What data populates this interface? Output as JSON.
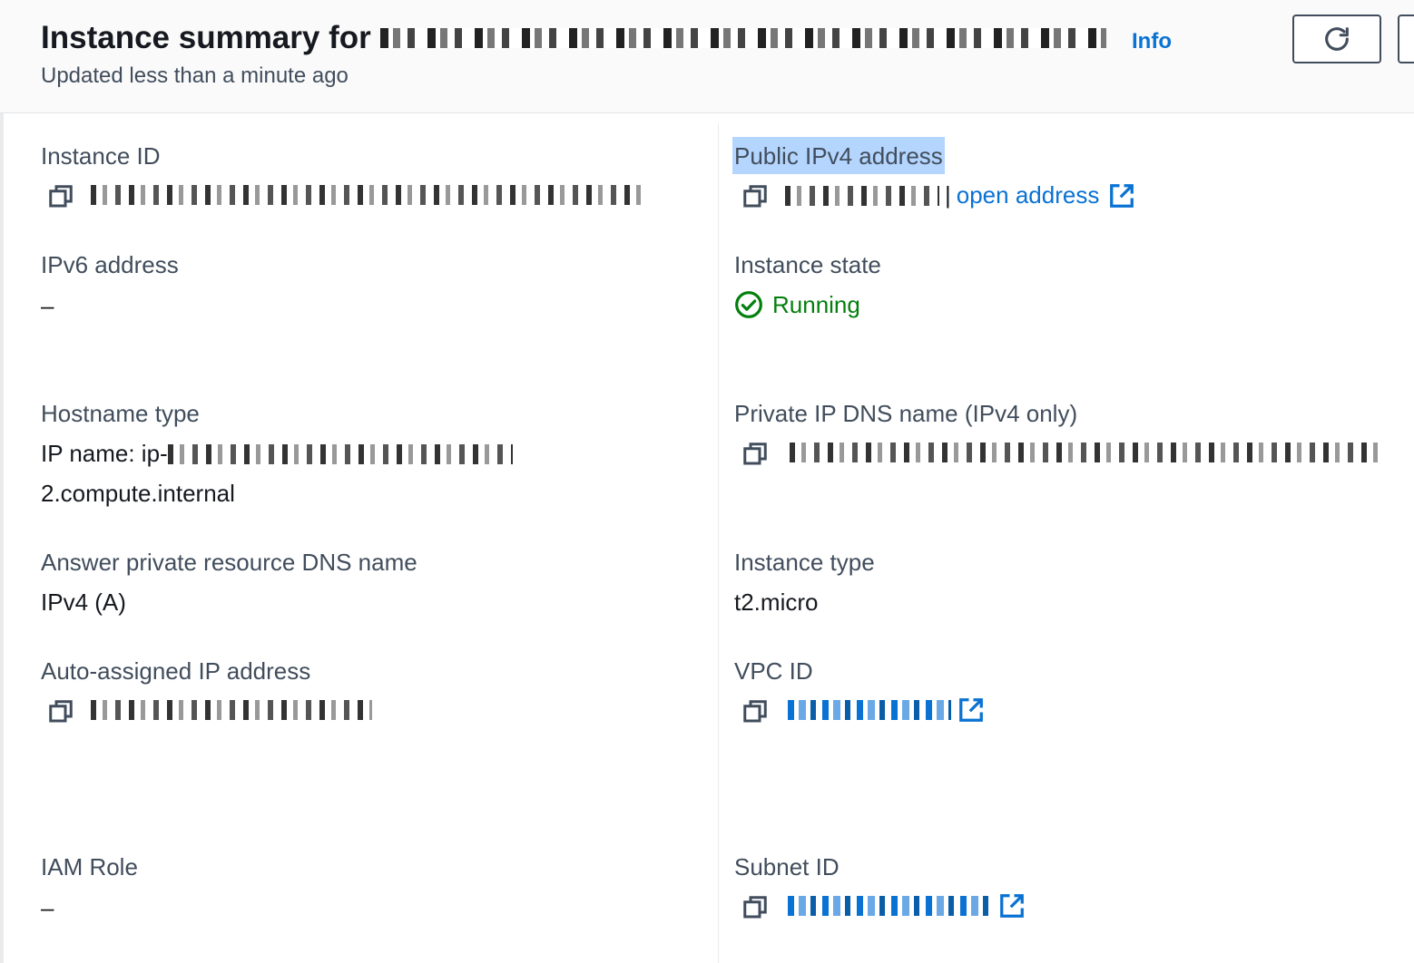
{
  "header": {
    "title_prefix": "Instance summary for",
    "info_label": "Info",
    "updated_text": "Updated less than a minute ago"
  },
  "left": {
    "instance_id": {
      "label": "Instance ID"
    },
    "ipv6": {
      "label": "IPv6 address",
      "value": "–"
    },
    "hostname_type": {
      "label": "Hostname type",
      "value_prefix": "IP name: ip-",
      "value_line2": "2.compute.internal"
    },
    "answer_dns": {
      "label": "Answer private resource DNS name",
      "value": "IPv4 (A)"
    },
    "auto_ip": {
      "label": "Auto-assigned IP address"
    },
    "iam_role": {
      "label": "IAM Role",
      "value": "–"
    }
  },
  "right": {
    "public_ipv4": {
      "label": "Public IPv4 address",
      "separator": "|",
      "open_link": "open address"
    },
    "instance_state": {
      "label": "Instance state",
      "value": "Running"
    },
    "private_dns": {
      "label": "Private IP DNS name (IPv4 only)"
    },
    "instance_type": {
      "label": "Instance type",
      "value": "t2.micro"
    },
    "vpc_id": {
      "label": "VPC ID"
    },
    "subnet_id": {
      "label": "Subnet ID"
    }
  },
  "icons": {
    "copy": "copy-icon",
    "external": "external-link-icon",
    "refresh": "refresh-icon",
    "status": "check-circle-icon"
  },
  "colors": {
    "link": "#0972d3",
    "success": "#037f0c",
    "label": "#414d5c",
    "text": "#16191f",
    "highlight": "#b4d5fe"
  }
}
